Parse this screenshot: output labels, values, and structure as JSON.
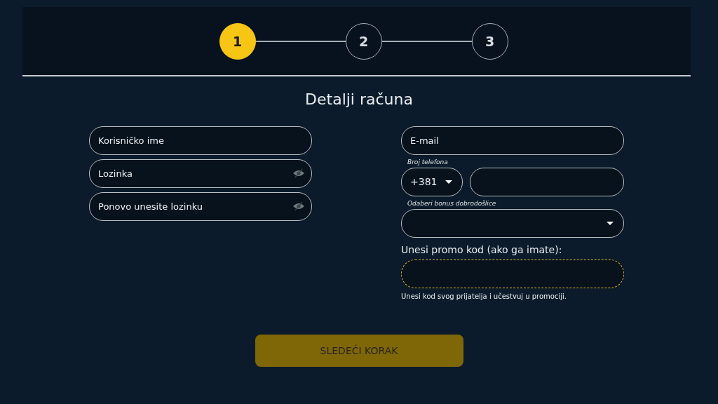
{
  "steps": [
    {
      "label": "1",
      "selected": true
    },
    {
      "label": "2",
      "selected": false
    },
    {
      "label": "3",
      "selected": false
    }
  ],
  "title": "Detalji računa",
  "left_fields": [
    {
      "placeholder": "Korisničko ime",
      "kind": "text"
    },
    {
      "placeholder": "Lozinka",
      "kind": "password"
    },
    {
      "placeholder": "Ponovo unesite lozinku",
      "kind": "password"
    }
  ],
  "email": {
    "placeholder": "E-mail"
  },
  "phone": {
    "label": "Broj telefona",
    "code": "+381"
  },
  "bonus": {
    "label": "Odaberi bonus dobrodošlice"
  },
  "promo": {
    "label": "Unesi promo kod (ako ga imate):",
    "hint": "Unesi kod svog prijatelja i učestvuj u promociji."
  },
  "next_button": {
    "label": "SLEDEĆI KORAK",
    "disabled": true
  }
}
